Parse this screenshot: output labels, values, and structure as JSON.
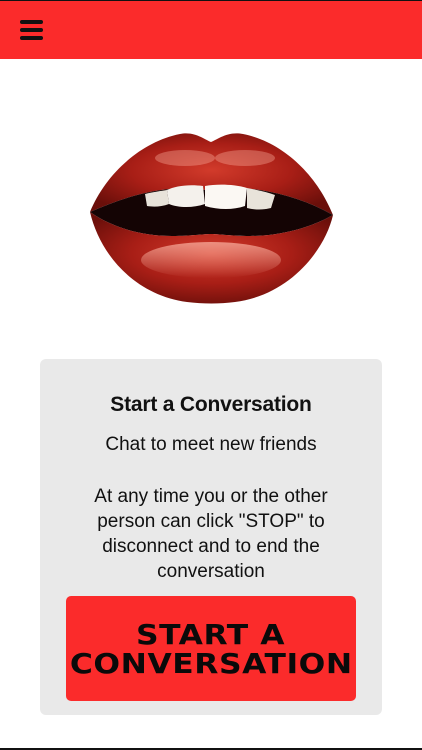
{
  "header": {
    "menu_icon": "hamburger-menu-icon",
    "accent_color": "#fb2b2b"
  },
  "hero": {
    "image": "red-lips-illustration"
  },
  "card": {
    "title": "Start a Conversation",
    "subtitle": "Chat to meet new friends",
    "body": "At any time you or the other person can click \"STOP\" to disconnect and to end the conversation",
    "button": {
      "line1": "START A",
      "line2": "CONVERSATION"
    },
    "background": "#e9e9e9"
  }
}
